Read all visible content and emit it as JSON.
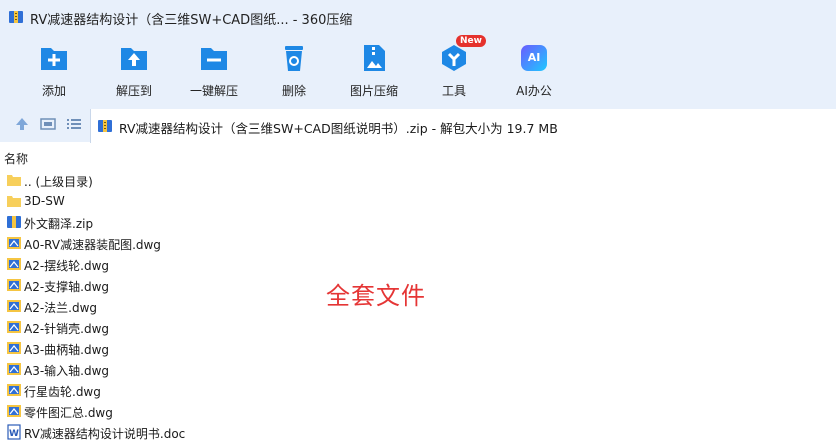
{
  "window": {
    "title": "RV减速器结构设计（含三维SW+CAD图纸... - 360压缩"
  },
  "toolbar": {
    "items": [
      {
        "label": "添加",
        "icon": "add-icon"
      },
      {
        "label": "解压到",
        "icon": "extract-to-icon"
      },
      {
        "label": "一键解压",
        "icon": "one-click-extract-icon"
      },
      {
        "label": "删除",
        "icon": "trash-icon"
      },
      {
        "label": "图片压缩",
        "icon": "image-compress-icon"
      },
      {
        "label": "工具",
        "icon": "tools-icon",
        "badge": "New"
      },
      {
        "label": "AI办公",
        "icon": "ai-office-icon",
        "icon_text": "AI"
      }
    ]
  },
  "address": {
    "text": "RV减速器结构设计（含三维SW+CAD图纸说明书）.zip - 解包大小为 19.7 MB"
  },
  "list": {
    "header": "名称",
    "items": [
      {
        "name": ".. (上级目录)",
        "type": "folder"
      },
      {
        "name": "3D-SW",
        "type": "folder"
      },
      {
        "name": "外文翻泽.zip",
        "type": "zip"
      },
      {
        "name": "A0-RV减速器装配图.dwg",
        "type": "dwg"
      },
      {
        "name": "A2-摆线轮.dwg",
        "type": "dwg"
      },
      {
        "name": "A2-支撑轴.dwg",
        "type": "dwg"
      },
      {
        "name": "A2-法兰.dwg",
        "type": "dwg"
      },
      {
        "name": "A2-针销壳.dwg",
        "type": "dwg"
      },
      {
        "name": "A3-曲柄轴.dwg",
        "type": "dwg"
      },
      {
        "name": "A3-输入轴.dwg",
        "type": "dwg"
      },
      {
        "name": "行星齿轮.dwg",
        "type": "dwg"
      },
      {
        "name": "零件图汇总.dwg",
        "type": "dwg"
      },
      {
        "name": "RV减速器结构设计说明书.doc",
        "type": "doc"
      }
    ]
  },
  "overlay_text": "全套文件",
  "colors": {
    "toolbar_bg": "#e8f0fb",
    "icon_blue": "#1e88e5",
    "overlay_red": "#e53535"
  }
}
